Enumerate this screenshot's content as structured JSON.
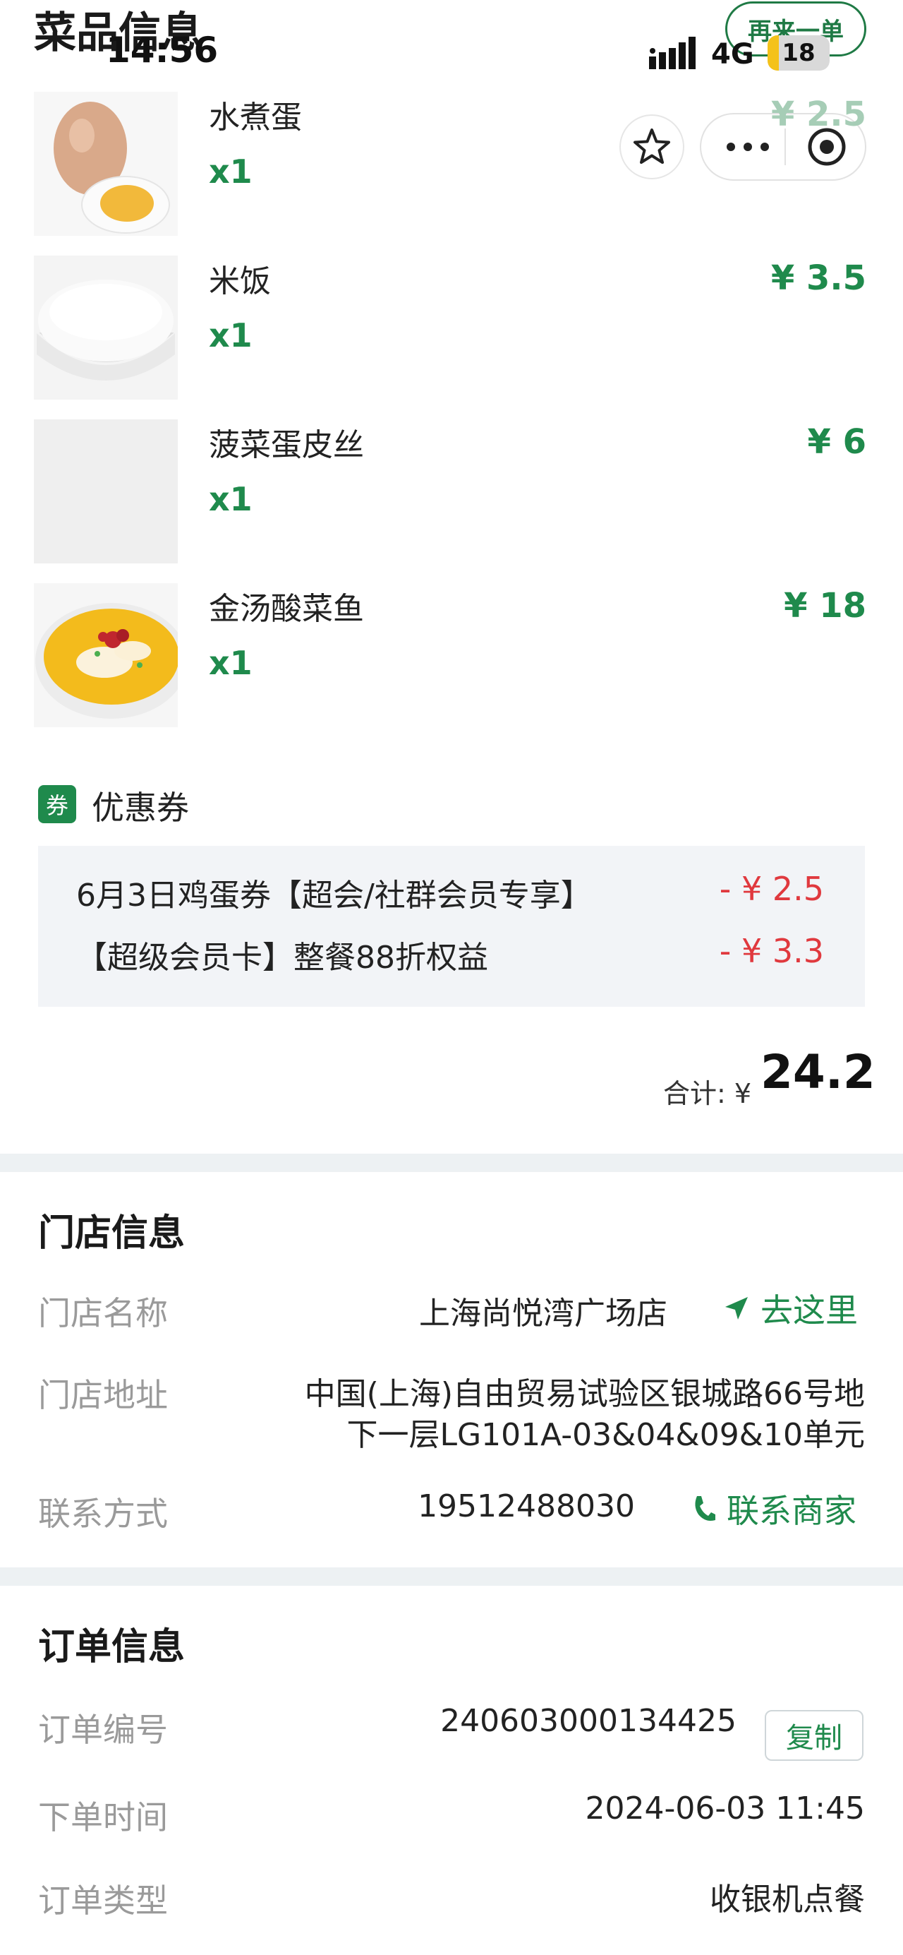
{
  "status_bar": {
    "time": "14:56",
    "network": "4G",
    "battery": "18",
    "battery_level": 0.18
  },
  "header": {
    "section_title": "菜品信息",
    "reorder_label": "再来一单"
  },
  "dishes": [
    {
      "name": "水煮蛋",
      "qty": "x1",
      "price": "¥ 2.5"
    },
    {
      "name": "米饭",
      "qty": "x1",
      "price": "¥ 3.5"
    },
    {
      "name": "菠菜蛋皮丝",
      "qty": "x1",
      "price": "¥ 6"
    },
    {
      "name": "金汤酸菜鱼",
      "qty": "x1",
      "price": "¥ 18"
    }
  ],
  "coupon": {
    "badge": "券",
    "title": "优惠券",
    "items": [
      {
        "name": "6月3日鸡蛋券【超会/社群会员专享】",
        "amount": "- ¥ 2.5"
      },
      {
        "name": "【超级会员卡】整餐88折权益",
        "amount": "- ¥ 3.3"
      }
    ]
  },
  "total": {
    "label": "合计: ¥",
    "value": "24.2"
  },
  "store": {
    "title": "门店信息",
    "name_label": "门店名称",
    "name": "上海尚悦湾广场店",
    "nav_label": "去这里",
    "address_label": "门店地址",
    "address_line1": "中国(上海)自由贸易试验区银城路66号地",
    "address_line2": "下一层LG101A-03&04&09&10单元",
    "contact_label": "联系方式",
    "phone": "19512488030",
    "contact_action": "联系商家"
  },
  "order": {
    "title": "订单信息",
    "number_label": "订单编号",
    "number": "240603000134425",
    "copy_label": "复制",
    "time_label": "下单时间",
    "time": "2024-06-03 11:45",
    "type_label": "订单类型",
    "type": "收银机点餐"
  },
  "colors": {
    "accent": "#1f8a4c",
    "discount": "#e0393e",
    "separator": "#edf1f3"
  }
}
